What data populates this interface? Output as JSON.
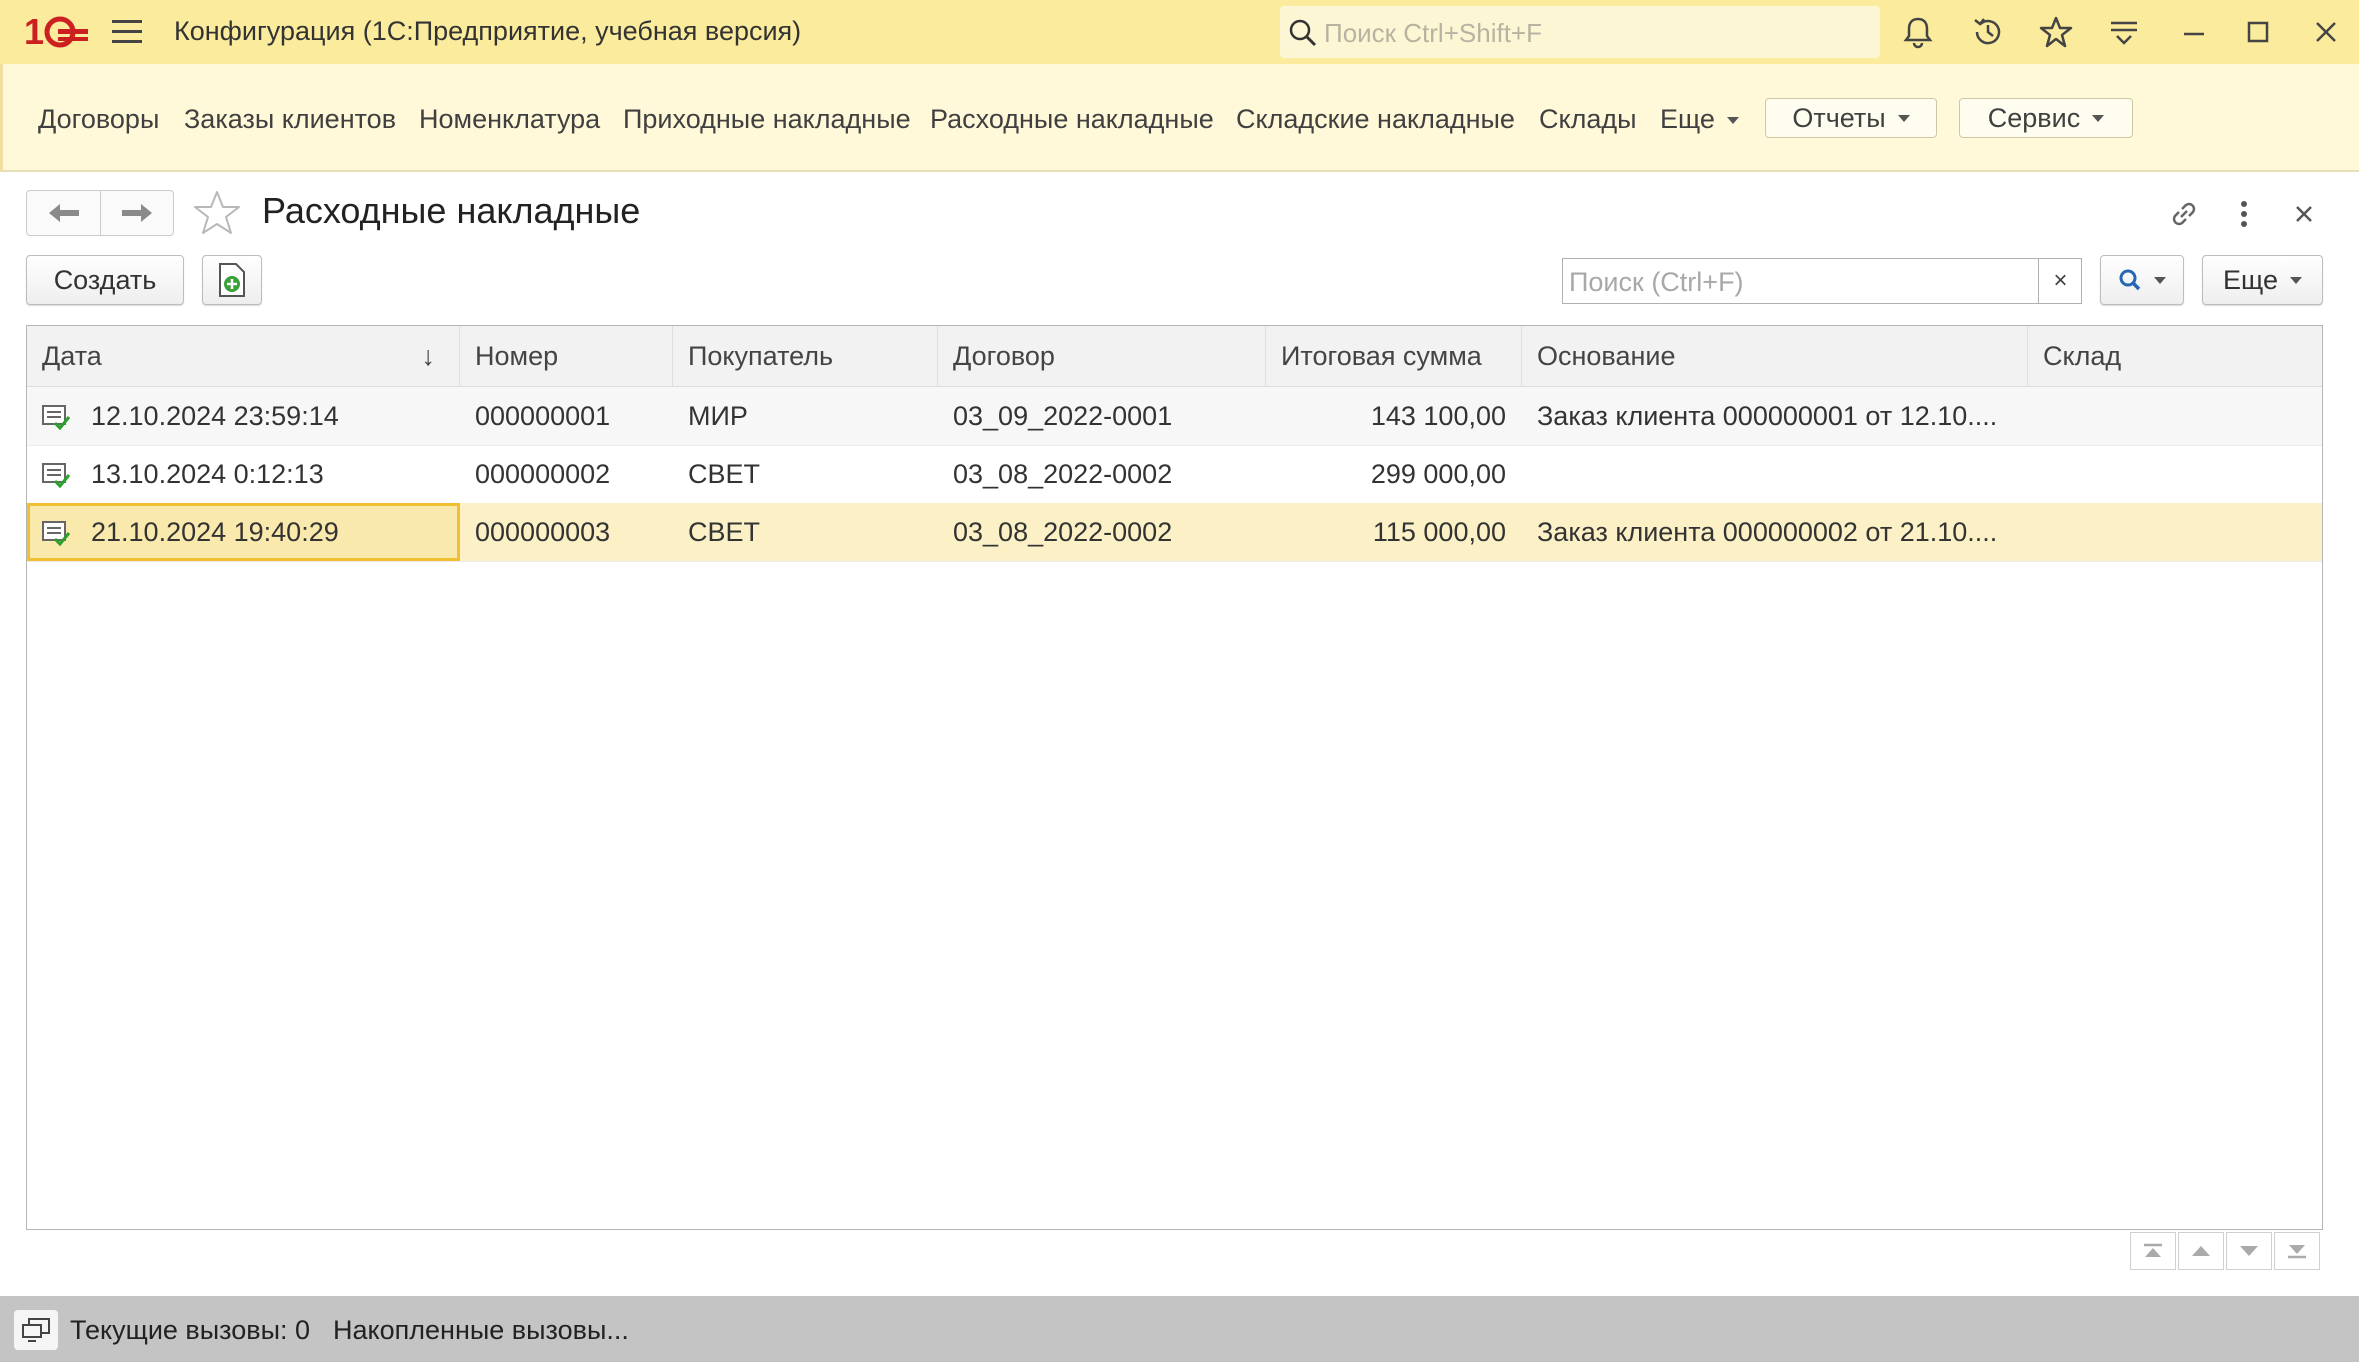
{
  "window": {
    "title": "Конфигурация  (1С:Предприятие, учебная версия)",
    "search_placeholder": "Поиск Ctrl+Shift+F",
    "accent_color": "#fbeb9c",
    "logo_color": "#cc1f1f"
  },
  "sections": {
    "items": [
      "Договоры",
      "Заказы клиентов",
      "Номенклатура",
      "Приходные накладные",
      "Расходные накладные",
      "Складские накладные",
      "Склады"
    ],
    "more_label": "Еще",
    "reports_label": "Отчеты",
    "service_label": "Сервис"
  },
  "form": {
    "title": "Расходные накладные",
    "create_label": "Создать",
    "search_placeholder": "Поиск (Ctrl+F)",
    "search_clear": "×",
    "more_label": "Еще"
  },
  "table": {
    "columns": [
      "Дата",
      "Номер",
      "Покупатель",
      "Договор",
      "Итоговая сумма",
      "Основание",
      "Склад"
    ],
    "sort_indicator": "↓",
    "rows": [
      {
        "date": "12.10.2024 23:59:14",
        "number": "000000001",
        "buyer": "МИР",
        "contract": "03_09_2022-0001",
        "sum": "143 100,00",
        "basis": "Заказ клиента 000000001 от 12.10....",
        "warehouse": ""
      },
      {
        "date": "13.10.2024 0:12:13",
        "number": "000000002",
        "buyer": "СВЕТ",
        "contract": "03_08_2022-0002",
        "sum": "299 000,00",
        "basis": "",
        "warehouse": ""
      },
      {
        "date": "21.10.2024 19:40:29",
        "number": "000000003",
        "buyer": "СВЕТ",
        "contract": "03_08_2022-0002",
        "sum": "115 000,00",
        "basis": "Заказ клиента 000000002 от 21.10....",
        "warehouse": ""
      }
    ],
    "selected_row": 3
  },
  "status": {
    "current_calls": "Текущие вызовы: 0",
    "accumulated_calls": "Накопленные вызовы..."
  }
}
